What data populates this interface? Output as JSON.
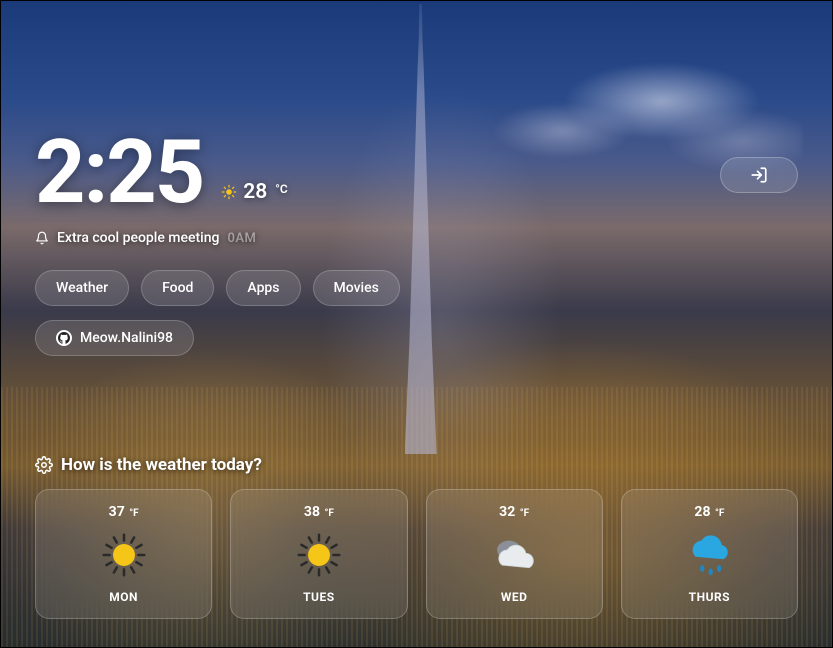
{
  "time": "2:25",
  "current": {
    "temp": "28",
    "unit": "°C"
  },
  "event": {
    "text": "Extra cool people meeting",
    "time": "0AM"
  },
  "tabs": [
    "Weather",
    "Food",
    "Apps",
    "Movies"
  ],
  "user": {
    "name": "Meow.Nalini98"
  },
  "weather_section_title": "How is the weather today?",
  "forecast": [
    {
      "temp": "37",
      "unit": "°F",
      "day": "MON",
      "icon": "sunny"
    },
    {
      "temp": "38",
      "unit": "°F",
      "day": "TUES",
      "icon": "sunny"
    },
    {
      "temp": "32",
      "unit": "°F",
      "day": "WED",
      "icon": "cloudy"
    },
    {
      "temp": "28",
      "unit": "°F",
      "day": "THURS",
      "icon": "rainy"
    }
  ]
}
